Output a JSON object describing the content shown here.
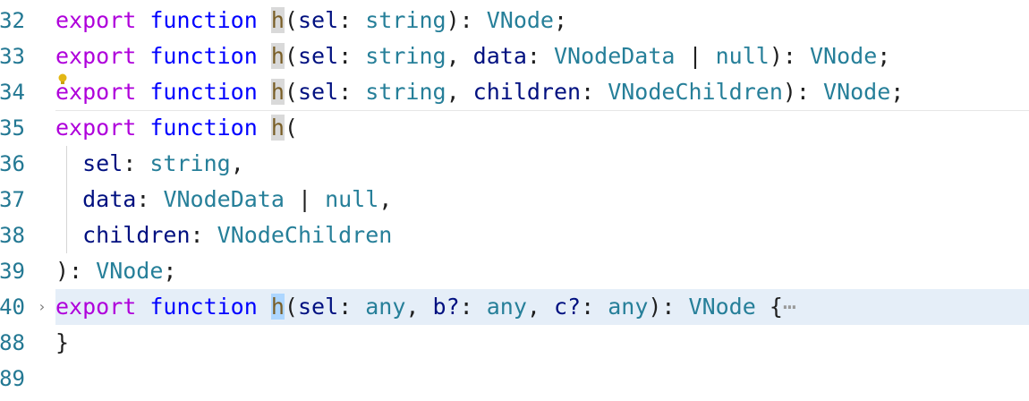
{
  "lines": [
    {
      "num": "32",
      "tokens": [
        [
          "kw",
          "export"
        ],
        [
          "punct",
          " "
        ],
        [
          "fn",
          "function"
        ],
        [
          "punct",
          " "
        ],
        [
          "name-hl",
          "h"
        ],
        [
          "punct",
          "("
        ],
        [
          "param",
          "sel"
        ],
        [
          "punct",
          ": "
        ],
        [
          "type",
          "string"
        ],
        [
          "punct",
          "): "
        ],
        [
          "type",
          "VNode"
        ],
        [
          "punct",
          ";"
        ]
      ]
    },
    {
      "num": "33",
      "tokens": [
        [
          "kw",
          "export"
        ],
        [
          "punct",
          " "
        ],
        [
          "fn",
          "function"
        ],
        [
          "punct",
          " "
        ],
        [
          "name-hl",
          "h"
        ],
        [
          "punct",
          "("
        ],
        [
          "param",
          "sel"
        ],
        [
          "punct",
          ": "
        ],
        [
          "type",
          "string"
        ],
        [
          "punct",
          ", "
        ],
        [
          "param",
          "data"
        ],
        [
          "punct",
          ": "
        ],
        [
          "type",
          "VNodeData"
        ],
        [
          "punct",
          " | "
        ],
        [
          "type",
          "null"
        ],
        [
          "punct",
          "): "
        ],
        [
          "type",
          "VNode"
        ],
        [
          "punct",
          ";"
        ]
      ]
    },
    {
      "num": "34",
      "tokens": [
        [
          "kw",
          "export"
        ],
        [
          "punct",
          " "
        ],
        [
          "fn",
          "function"
        ],
        [
          "punct",
          " "
        ],
        [
          "name-hl",
          "h"
        ],
        [
          "punct",
          "("
        ],
        [
          "param",
          "sel"
        ],
        [
          "punct",
          ": "
        ],
        [
          "type",
          "string"
        ],
        [
          "punct",
          ", "
        ],
        [
          "param",
          "children"
        ],
        [
          "punct",
          ": "
        ],
        [
          "type",
          "VNodeChildren"
        ],
        [
          "punct",
          "): "
        ],
        [
          "type",
          "VNode"
        ],
        [
          "punct",
          ";"
        ]
      ]
    },
    {
      "num": "35",
      "tokens": [
        [
          "kw",
          "export"
        ],
        [
          "punct",
          " "
        ],
        [
          "fn",
          "function"
        ],
        [
          "punct",
          " "
        ],
        [
          "name-hl",
          "h"
        ],
        [
          "punct",
          "("
        ]
      ]
    },
    {
      "num": "36",
      "tokens": [
        [
          "punct",
          "  "
        ],
        [
          "param",
          "sel"
        ],
        [
          "punct",
          ": "
        ],
        [
          "type",
          "string"
        ],
        [
          "punct",
          ","
        ]
      ]
    },
    {
      "num": "37",
      "tokens": [
        [
          "punct",
          "  "
        ],
        [
          "param",
          "data"
        ],
        [
          "punct",
          ": "
        ],
        [
          "type",
          "VNodeData"
        ],
        [
          "punct",
          " | "
        ],
        [
          "type",
          "null"
        ],
        [
          "punct",
          ","
        ]
      ]
    },
    {
      "num": "38",
      "tokens": [
        [
          "punct",
          "  "
        ],
        [
          "param",
          "children"
        ],
        [
          "punct",
          ": "
        ],
        [
          "type",
          "VNodeChildren"
        ]
      ]
    },
    {
      "num": "39",
      "tokens": [
        [
          "punct",
          "): "
        ],
        [
          "type",
          "VNode"
        ],
        [
          "punct",
          ";"
        ]
      ]
    },
    {
      "num": "40",
      "tokens": [
        [
          "kw",
          "export"
        ],
        [
          "punct",
          " "
        ],
        [
          "fn",
          "function"
        ],
        [
          "punct",
          " "
        ],
        [
          "name-sel",
          "h"
        ],
        [
          "punct",
          "("
        ],
        [
          "param",
          "sel"
        ],
        [
          "punct",
          ": "
        ],
        [
          "type",
          "any"
        ],
        [
          "punct",
          ", "
        ],
        [
          "param",
          "b?"
        ],
        [
          "punct",
          ": "
        ],
        [
          "type",
          "any"
        ],
        [
          "punct",
          ", "
        ],
        [
          "param",
          "c?"
        ],
        [
          "punct",
          ": "
        ],
        [
          "type",
          "any"
        ],
        [
          "punct",
          "): "
        ],
        [
          "type",
          "VNode"
        ],
        [
          "punct",
          " {"
        ],
        [
          "ellipsis",
          "⋯"
        ]
      ]
    },
    {
      "num": "88",
      "tokens": [
        [
          "punct",
          "}"
        ]
      ]
    },
    {
      "num": "89",
      "tokens": []
    }
  ],
  "fold_icon": "chevron-right-icon",
  "lightbulb_icon": "lightbulb-icon",
  "colors": {
    "keyword": "#af00db",
    "function_kw": "#0000ff",
    "type": "#267f99",
    "param": "#001080",
    "line_number": "#237893",
    "current_line": "#e5eef8"
  }
}
